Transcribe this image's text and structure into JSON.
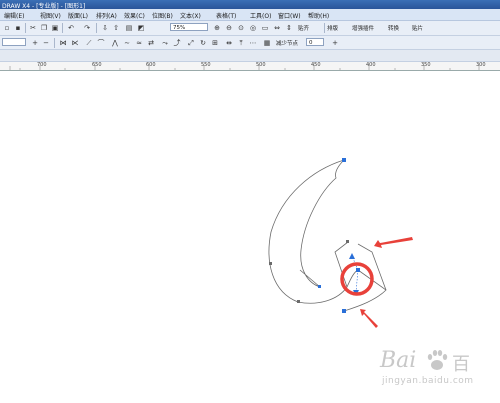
{
  "window": {
    "title": "DRAW X4 - [专业版] - [图形1]"
  },
  "menu": [
    "编辑(E)",
    "视图(V)",
    "版面(L)",
    "排列(A)",
    "效果(C)",
    "位图(B)",
    "文本(X)",
    "表格(T)",
    "工具(O)",
    "窗口(W)",
    "帮助(H)"
  ],
  "toolbar": {
    "zoom": "75%",
    "snap_label": "贴齐",
    "extra_labels": [
      "排版",
      "增强插件",
      "转换",
      "贴片"
    ]
  },
  "propbar": {
    "node_label": "减少节点",
    "node_value": "0"
  },
  "ruler": {
    "labels": [
      "700",
      "650",
      "600",
      "550",
      "500",
      "450",
      "400",
      "350",
      "300"
    ]
  },
  "watermark": {
    "brand_left": "Bai",
    "brand_right": "百",
    "sub": "jingyan.baidu.com"
  },
  "colors": {
    "annotation_red": "#e8413a",
    "node_blue": "#2a6fd8",
    "curve": "#6b6b6b"
  }
}
